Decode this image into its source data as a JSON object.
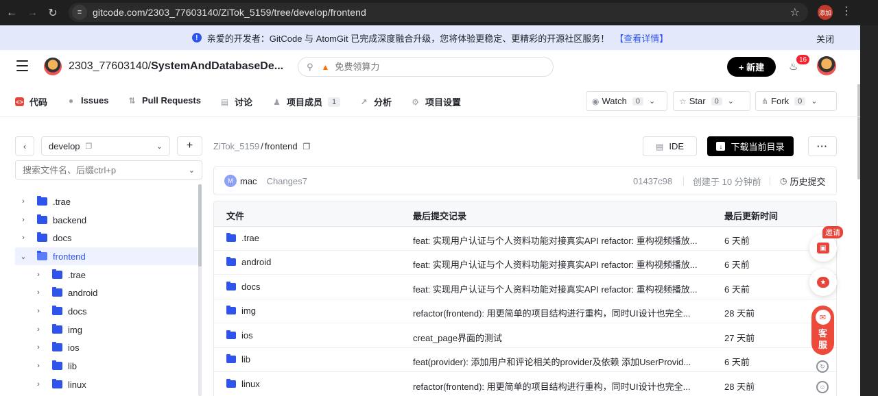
{
  "browser": {
    "url": "gitcode.com/2303_77603140/ZiTok_5159/tree/develop/frontend",
    "profile_label": "添加"
  },
  "banner": {
    "text": "亲爱的开发者：GitCode 与 AtomGit 已完成深度融合升级，您将体验更稳定、更精彩的开源社区服务！",
    "link": "【查看详情】",
    "close": "关闭"
  },
  "header": {
    "owner": "2303_77603140/",
    "repo": "SystemAndDatabaseDe...",
    "search_placeholder": "免费领算力",
    "new_button": "+ 新建",
    "notification_count": "16"
  },
  "tabs": [
    {
      "label": "代码",
      "icon": "code-icon"
    },
    {
      "label": "Issues",
      "icon": "issues-icon"
    },
    {
      "label": "Pull Requests",
      "icon": "pull-request-icon"
    },
    {
      "label": "讨论",
      "icon": "discussion-icon"
    },
    {
      "label": "项目成员",
      "icon": "members-icon",
      "count": "1"
    },
    {
      "label": "分析",
      "icon": "analytics-icon"
    },
    {
      "label": "项目设置",
      "icon": "settings-icon"
    }
  ],
  "repo_actions": {
    "watch_label": "Watch",
    "watch_count": "0",
    "star_label": "Star",
    "star_count": "0",
    "fork_label": "Fork",
    "fork_count": "0"
  },
  "sidebar": {
    "branch": "develop",
    "file_search_placeholder": "搜索文件名、后缀ctrl+p",
    "tree": [
      {
        "label": ".trae",
        "depth": 0,
        "expanded": false
      },
      {
        "label": "backend",
        "depth": 0,
        "expanded": false
      },
      {
        "label": "docs",
        "depth": 0,
        "expanded": false
      },
      {
        "label": "frontend",
        "depth": 0,
        "expanded": true,
        "selected": true
      },
      {
        "label": ".trae",
        "depth": 1,
        "expanded": false
      },
      {
        "label": "android",
        "depth": 1,
        "expanded": false
      },
      {
        "label": "docs",
        "depth": 1,
        "expanded": false
      },
      {
        "label": "img",
        "depth": 1,
        "expanded": false
      },
      {
        "label": "ios",
        "depth": 1,
        "expanded": false
      },
      {
        "label": "lib",
        "depth": 1,
        "expanded": false
      },
      {
        "label": "linux",
        "depth": 1,
        "expanded": false
      }
    ]
  },
  "main": {
    "breadcrumb_repo": "ZiTok_5159",
    "breadcrumb_sep": "/",
    "breadcrumb_dir": "frontend",
    "ide_button": "IDE",
    "download_button": "下载当前目录",
    "more_button": "···",
    "commit": {
      "avatar_letter": "M",
      "author": "mac",
      "message": "Changes7",
      "sha": "01437c98",
      "time": "创建于 10 分钟前",
      "history": "历史提交"
    },
    "table_headers": [
      "文件",
      "最后提交记录",
      "最后更新时间"
    ],
    "files": [
      {
        "name": ".trae",
        "commit": "feat: 实现用户认证与个人资料功能对接真实API refactor: 重构视频播放...",
        "time": "6 天前"
      },
      {
        "name": "android",
        "commit": "feat: 实现用户认证与个人资料功能对接真实API refactor: 重构视频播放...",
        "time": "6 天前"
      },
      {
        "name": "docs",
        "commit": "feat: 实现用户认证与个人资料功能对接真实API refactor: 重构视频播放...",
        "time": "6 天前"
      },
      {
        "name": "img",
        "commit": "refactor(frontend): 用更简单的项目结构进行重构，同时UI设计也完全...",
        "time": "28 天前"
      },
      {
        "name": "ios",
        "commit": "creat_page界面的测试",
        "time": "27 天前"
      },
      {
        "name": "lib",
        "commit": "feat(provider): 添加用户和评论相关的provider及依赖 添加UserProvid...",
        "time": "6 天前"
      },
      {
        "name": "linux",
        "commit": "refactor(frontend): 用更简单的项目结构进行重构，同时UI设计也完全...",
        "time": "28 天前"
      }
    ]
  },
  "floating": {
    "invite": "邀请",
    "service": "客服"
  },
  "colors": {
    "accent": "#2f54eb",
    "banner_bg": "#e3e8fb",
    "active_tab_icon": "#e5453a",
    "primary_button": "#000000"
  }
}
